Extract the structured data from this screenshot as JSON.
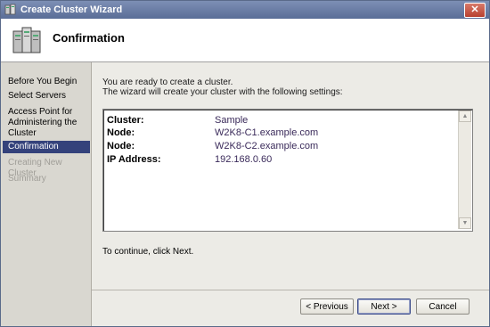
{
  "window": {
    "title": "Create Cluster Wizard",
    "close_glyph": "✕"
  },
  "header": {
    "title": "Confirmation",
    "icon": "cluster-servers-icon"
  },
  "nav": {
    "items": [
      {
        "label": "Before You Begin",
        "state": "normal"
      },
      {
        "label": "Select Servers",
        "state": "normal"
      },
      {
        "label": "Access Point for Administering the Cluster",
        "state": "normal"
      },
      {
        "label": "Confirmation",
        "state": "selected"
      },
      {
        "label": "Creating New Cluster",
        "state": "disabled"
      },
      {
        "label": "Summary",
        "state": "disabled"
      }
    ]
  },
  "content": {
    "intro_line1": "You are ready to create a cluster.",
    "intro_line2": "The wizard will create your cluster with the following settings:",
    "settings": [
      {
        "label": "Cluster:",
        "value": "Sample"
      },
      {
        "label": "Node:",
        "value": "W2K8-C1.example.com"
      },
      {
        "label": "Node:",
        "value": "W2K8-C2.example.com"
      },
      {
        "label": "IP Address:",
        "value": "192.168.0.60"
      }
    ],
    "continue_text": "To continue, click Next."
  },
  "buttons": {
    "previous": "< Previous",
    "next": "Next >",
    "cancel": "Cancel"
  },
  "scroll": {
    "up_glyph": "▲",
    "down_glyph": "▼"
  },
  "colors": {
    "selected_nav_bg": "#34427b",
    "title_bar": "#5a6d97",
    "value_text": "#3a2a5a"
  }
}
